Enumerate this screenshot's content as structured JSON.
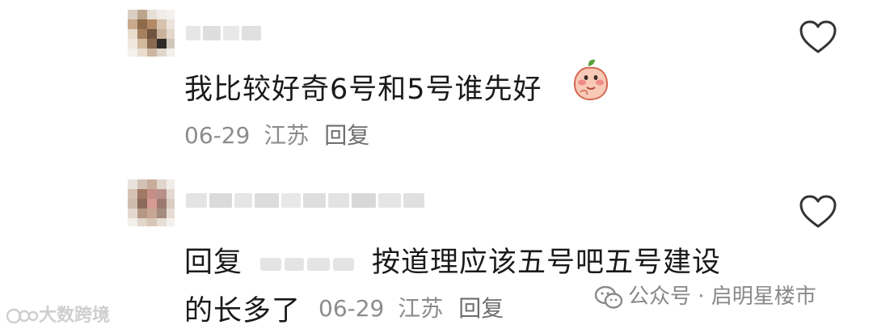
{
  "comments": [
    {
      "text": "我比较好奇6号和5号谁先好",
      "emoji": "peach-blush-emoji",
      "date": "06-29",
      "location": "江苏",
      "reply_label": "回复"
    },
    {
      "reply_prefix": "回复",
      "text_line1": "按道理应该五号吧五号建设",
      "text_line2": "的长多了",
      "date": "06-29",
      "location": "江苏",
      "reply_label": "回复"
    }
  ],
  "footer": {
    "wechat_account": "公众号 · 启明星楼市",
    "watermark": "大数跨境"
  },
  "colors": {
    "text": "#1a1a1a",
    "meta": "#8c8c8c",
    "icon": "#333333"
  }
}
